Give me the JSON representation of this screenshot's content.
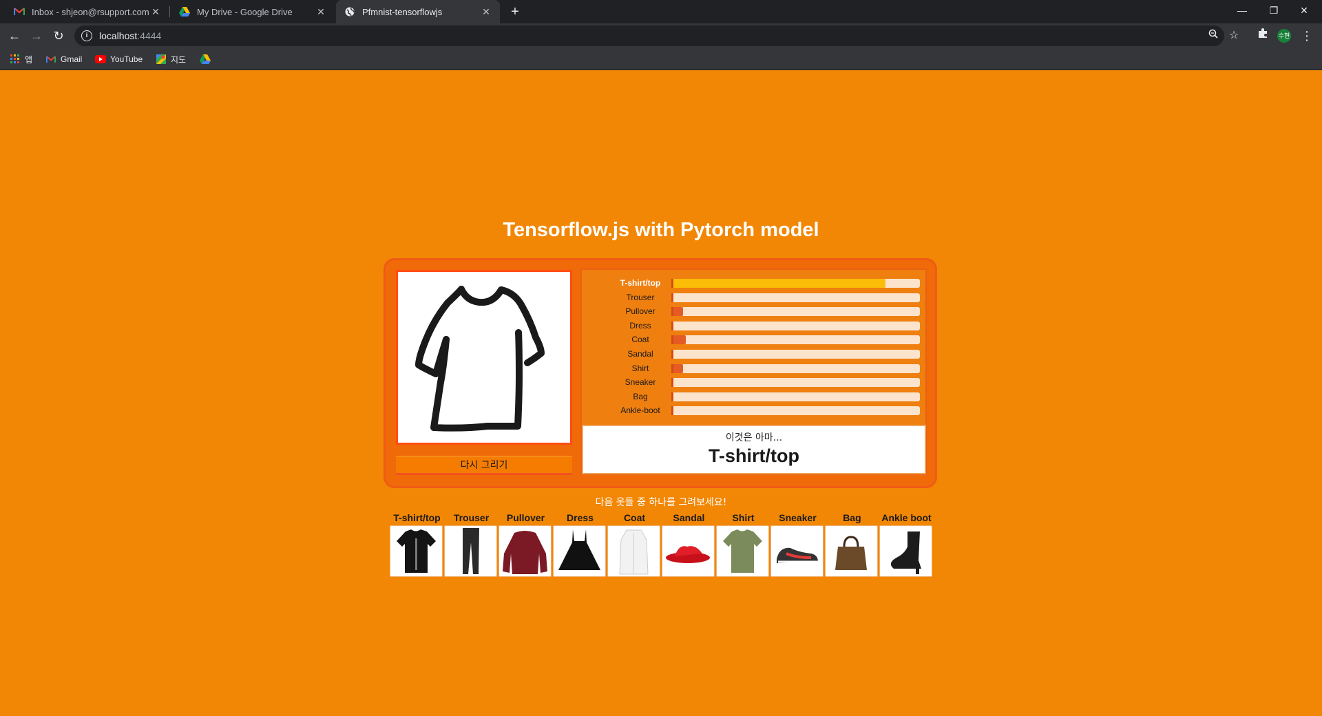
{
  "browser": {
    "tabs": [
      {
        "title": "Inbox - shjeon@rsupport.com -",
        "icon": "gmail-icon",
        "active": false
      },
      {
        "title": "My Drive - Google Drive",
        "icon": "google-drive-icon",
        "active": false
      },
      {
        "title": "Pfmnist-tensorflowjs",
        "icon": "globe-icon",
        "active": true
      }
    ],
    "new_tab": "+",
    "close_glyph": "✕",
    "window_controls": {
      "minimize": "—",
      "restore": "❐",
      "close": "✕"
    },
    "url": {
      "host": "localhost",
      "port": ":4444"
    },
    "avatar_text": "수현",
    "bookmarks": [
      {
        "label": "앱",
        "icon": "apps-grid-icon"
      },
      {
        "label": "Gmail",
        "icon": "gmail-icon"
      },
      {
        "label": "YouTube",
        "icon": "youtube-icon"
      },
      {
        "label": "지도",
        "icon": "maps-icon"
      },
      {
        "label": "",
        "icon": "google-drive-icon"
      }
    ]
  },
  "page": {
    "title": "Tensorflow.js with Pytorch model",
    "redraw_button": "다시 그리기",
    "prediction_intro": "이것은 아마...",
    "prediction": "T-shirt/top",
    "instruction": "다음 옷들 중 하나를 그려보세요!",
    "colors": {
      "background": "#f28705",
      "panel": "#f06a0a",
      "top_bar": "#fbbd08",
      "other_bar": "#e45b25"
    }
  },
  "chart_data": {
    "type": "bar",
    "orientation": "horizontal",
    "categories": [
      "T-shirt/top",
      "Trouser",
      "Pullover",
      "Dress",
      "Coat",
      "Sandal",
      "Shirt",
      "Sneaker",
      "Bag",
      "Ankle-boot"
    ],
    "values": [
      0.86,
      0.0,
      0.04,
      0.0,
      0.05,
      0.0,
      0.04,
      0.0,
      0.0,
      0.0
    ],
    "xlim": [
      0,
      1
    ],
    "highlighted": "T-shirt/top"
  },
  "examples": [
    {
      "label": "T-shirt/top",
      "icon": "tshirt-photo"
    },
    {
      "label": "Trouser",
      "icon": "trouser-photo"
    },
    {
      "label": "Pullover",
      "icon": "pullover-photo"
    },
    {
      "label": "Dress",
      "icon": "dress-photo"
    },
    {
      "label": "Coat",
      "icon": "coat-photo"
    },
    {
      "label": "Sandal",
      "icon": "sandal-photo"
    },
    {
      "label": "Shirt",
      "icon": "shirt-photo"
    },
    {
      "label": "Sneaker",
      "icon": "sneaker-photo"
    },
    {
      "label": "Bag",
      "icon": "bag-photo"
    },
    {
      "label": "Ankle boot",
      "icon": "ankle-boot-photo"
    }
  ]
}
